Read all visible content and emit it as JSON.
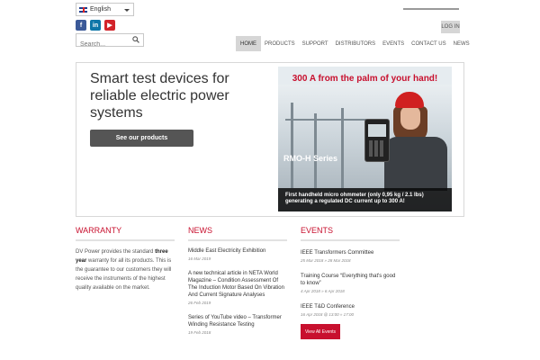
{
  "language": {
    "selected": "English",
    "flag_icon": "uk-flag-icon"
  },
  "social": [
    {
      "name": "facebook-icon",
      "glyph": "f",
      "color": "#3b5998"
    },
    {
      "name": "linkedin-icon",
      "glyph": "in",
      "color": "#0e76a8"
    },
    {
      "name": "youtube-icon",
      "glyph": "▶",
      "color": "#d2232a"
    }
  ],
  "search": {
    "placeholder": "Search..."
  },
  "header": {
    "login_label": "LOG IN"
  },
  "nav": {
    "items": [
      "HOME",
      "PRODUCTS",
      "SUPPORT",
      "DISTRIBUTORS",
      "EVENTS",
      "CONTACT US",
      "NEWS"
    ],
    "active": "HOME"
  },
  "hero": {
    "title": "Smart test devices for reliable electric power systems",
    "button_label": "See our products",
    "promo": {
      "headline": "300 A from the palm of your hand!",
      "series": "RMO-H Series",
      "caption": "First handheld micro ohmmeter (only 0,95 kg / 2.1 lbs) generating a regulated DC current up to 300 A!"
    }
  },
  "warranty": {
    "title": "WARRANTY",
    "text_before": "DV Power provides the standard",
    "text_bold": "three year",
    "text_after": "warranty for all its products. This is the guarantee to our customers they will receive the instruments of the highest quality available on the market."
  },
  "news": {
    "title": "NEWS",
    "items": [
      {
        "title": "Middle East Electricity Exhibition",
        "date": "16 Mar 2019"
      },
      {
        "title": "A new technical article in NETA World Magazine – Condition Assessment Of The Induction Motor Based On Vibration And Current Signature Analyses",
        "date": "26 Feb 2019"
      },
      {
        "title": "Series of YouTube video – Transformer Winding Resistance Testing",
        "date": "19 Feb 2018"
      }
    ]
  },
  "events": {
    "title": "EVENTS",
    "items": [
      {
        "title": "IEEE Transformers Committee",
        "date": "25 Mar 2018 » 28 Mar 2018"
      },
      {
        "title": "Training Course “Everything that's good to know”",
        "date": "4 Apr 2018 » 6 Apr 2018"
      },
      {
        "title": "IEEE T&D Conference",
        "date": "16 Apr 2018 @ 13:00 » 17:00"
      }
    ],
    "button_label": "View All Events"
  },
  "colors": {
    "accent": "#c8102e",
    "button_dark": "#555555",
    "nav_active": "#d6d6d6"
  }
}
